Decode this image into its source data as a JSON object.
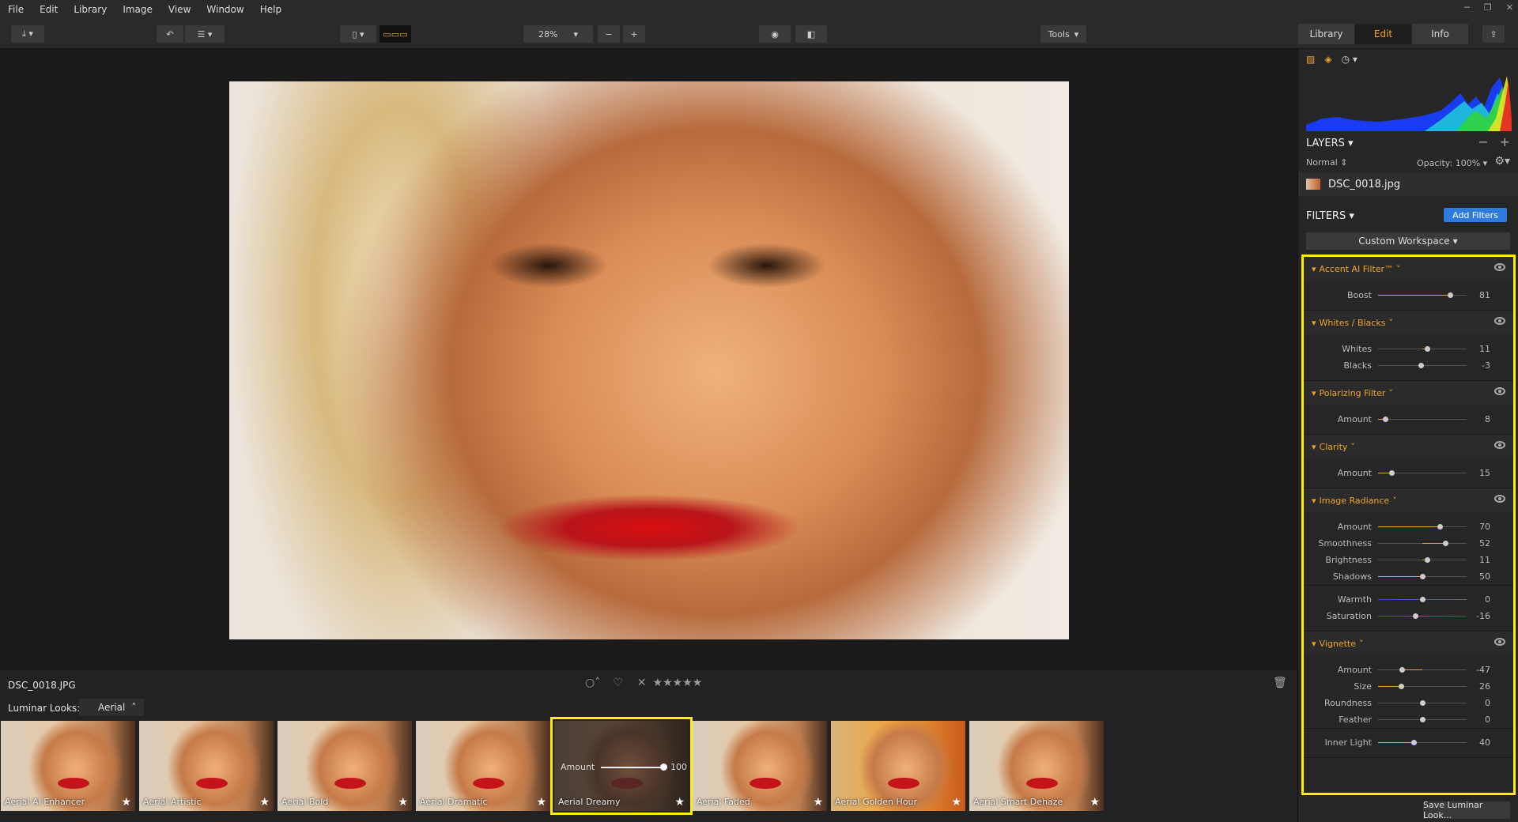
{
  "menu": [
    "File",
    "Edit",
    "Library",
    "Image",
    "View",
    "Window",
    "Help"
  ],
  "toolbar": {
    "zoom": "28%",
    "tools_label": "Tools",
    "tabs": [
      "Library",
      "Edit",
      "Info"
    ],
    "active_tab": "Edit"
  },
  "image": {
    "filename": "DSC_0018.JPG"
  },
  "filmstrip": {
    "looks_label": "Luminar Looks:",
    "looks_category": "Aerial",
    "amount_label": "Amount",
    "amount_value": "100",
    "thumbs": [
      {
        "label": "Aerial AI Enhancer"
      },
      {
        "label": "Aerial Artistic"
      },
      {
        "label": "Aerial Bold"
      },
      {
        "label": "Aerial Dramatic"
      },
      {
        "label": "Aerial Dreamy"
      },
      {
        "label": "Aerial Faded"
      },
      {
        "label": "Aerial Golden Hour"
      },
      {
        "label": "Aerial Smart Dehaze"
      }
    ],
    "selected": "Aerial Dreamy"
  },
  "panel": {
    "layers_title": "LAYERS",
    "blend_mode": "Normal",
    "opacity": "Opacity: 100%",
    "layer_name": "DSC_0018.jpg",
    "filters_title": "FILTERS",
    "add_filters": "Add Filters",
    "workspace": "Custom Workspace",
    "save_look": "Save Luminar Look..."
  },
  "filters": [
    {
      "name": "Accent AI Filter™",
      "sliders": [
        {
          "label": "Boost",
          "value": 81,
          "min": 0,
          "max": 100
        }
      ]
    },
    {
      "name": "Whites / Blacks",
      "sliders": [
        {
          "label": "Whites",
          "value": 11,
          "min": -100,
          "max": 100
        },
        {
          "label": "Blacks",
          "value": -3,
          "min": -100,
          "max": 100
        }
      ]
    },
    {
      "name": "Polarizing Filter",
      "sliders": [
        {
          "label": "Amount",
          "value": 8,
          "min": 0,
          "max": 100
        }
      ]
    },
    {
      "name": "Clarity",
      "sliders": [
        {
          "label": "Amount",
          "value": 15,
          "min": 0,
          "max": 100
        }
      ]
    },
    {
      "name": "Image Radiance",
      "sliders": [
        {
          "label": "Amount",
          "value": 70,
          "min": 0,
          "max": 100
        },
        {
          "label": "Smoothness",
          "value": 52,
          "min": -100,
          "max": 100
        },
        {
          "label": "Brightness",
          "value": 11,
          "min": -100,
          "max": 100
        },
        {
          "label": "Shadows",
          "value": 50,
          "min": 0,
          "max": 100
        },
        {
          "label": "Warmth",
          "value": 0,
          "min": -100,
          "max": 100,
          "style": "warm"
        },
        {
          "label": "Saturation",
          "value": -16,
          "min": -100,
          "max": 100,
          "style": "sat"
        }
      ]
    },
    {
      "name": "Vignette",
      "sliders": [
        {
          "label": "Amount",
          "value": -47,
          "min": -100,
          "max": 100
        },
        {
          "label": "Size",
          "value": 26,
          "min": 0,
          "max": 100
        },
        {
          "label": "Roundness",
          "value": 0,
          "min": -100,
          "max": 100
        },
        {
          "label": "Feather",
          "value": 0,
          "min": -100,
          "max": 100
        },
        {
          "label": "Inner Light",
          "value": 40,
          "min": 0,
          "max": 100
        }
      ]
    }
  ],
  "colors": {
    "accent": "#f0a52a",
    "highlight_border": "#ffee00",
    "primary_button": "#2e7be0"
  }
}
